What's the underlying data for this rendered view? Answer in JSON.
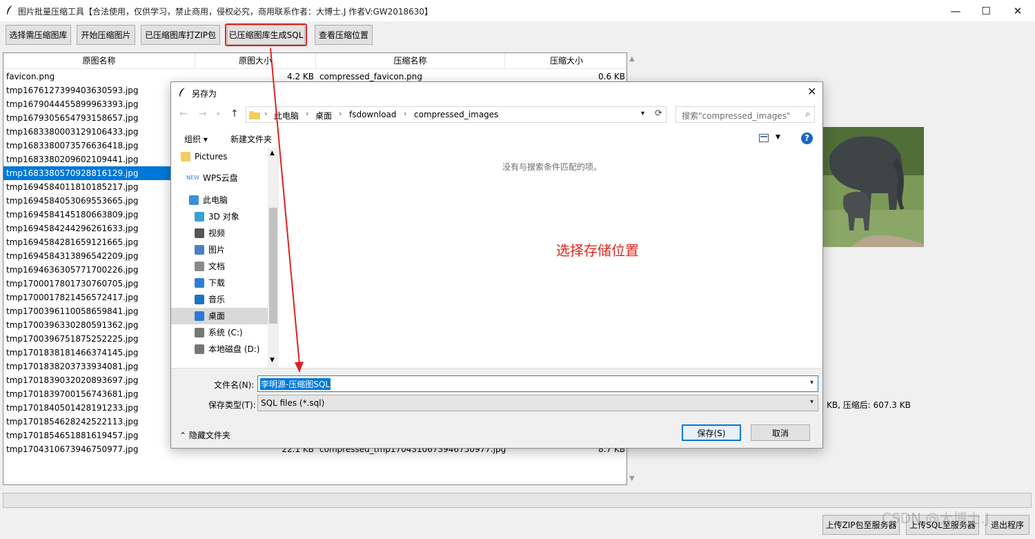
{
  "window": {
    "title": "图片批量压缩工具【合法使用，仅供学习，禁止商用，侵权必究，商用联系作者：大博士.J 作者V:GW2018630】",
    "minimize": "—",
    "maximize": "☐",
    "close": "✕"
  },
  "toolbar": {
    "select_folder": "选择需压缩图库",
    "start": "开始压缩图片",
    "zip": "已压缩图库打ZIP包",
    "gen_sql": "已压缩图库生成SQL",
    "view_location": "查看压缩位置"
  },
  "table": {
    "headers": [
      "原图名称",
      "原图大小",
      "压缩名称",
      "压缩大小"
    ],
    "rows": [
      {
        "name": "favicon.png",
        "size": "4.2 KB",
        "cname": "compressed_favicon.png",
        "csize": "0.6 KB"
      },
      {
        "name": "tmp1676127399403630593.jpg",
        "size": "",
        "cname": "",
        "csize": ""
      },
      {
        "name": "tmp1679044455899963393.jpg",
        "size": "",
        "cname": "",
        "csize": ""
      },
      {
        "name": "tmp1679305654793158657.jpg",
        "size": "",
        "cname": "",
        "csize": ""
      },
      {
        "name": "tmp1683380003129106433.jpg",
        "size": "",
        "cname": "",
        "csize": ""
      },
      {
        "name": "tmp1683380073576636418.jpg",
        "size": "",
        "cname": "",
        "csize": ""
      },
      {
        "name": "tmp1683380209602109441.jpg",
        "size": "",
        "cname": "",
        "csize": ""
      },
      {
        "name": "tmp1683380570928816129.jpg",
        "size": "",
        "cname": "",
        "csize": ""
      },
      {
        "name": "tmp1694584011810185217.jpg",
        "size": "",
        "cname": "",
        "csize": ""
      },
      {
        "name": "tmp1694584053069553665.jpg",
        "size": "",
        "cname": "",
        "csize": ""
      },
      {
        "name": "tmp1694584145180663809.jpg",
        "size": "",
        "cname": "",
        "csize": ""
      },
      {
        "name": "tmp1694584244296261633.jpg",
        "size": "",
        "cname": "",
        "csize": ""
      },
      {
        "name": "tmp1694584281659121665.jpg",
        "size": "",
        "cname": "",
        "csize": ""
      },
      {
        "name": "tmp1694584313896542209.jpg",
        "size": "",
        "cname": "",
        "csize": ""
      },
      {
        "name": "tmp1694636305771700226.jpg",
        "size": "",
        "cname": "",
        "csize": ""
      },
      {
        "name": "tmp1700017801730760705.jpg",
        "size": "",
        "cname": "",
        "csize": ""
      },
      {
        "name": "tmp1700017821456572417.jpg",
        "size": "",
        "cname": "",
        "csize": ""
      },
      {
        "name": "tmp1700396110058659841.jpg",
        "size": "",
        "cname": "",
        "csize": ""
      },
      {
        "name": "tmp1700396330280591362.jpg",
        "size": "",
        "cname": "",
        "csize": ""
      },
      {
        "name": "tmp1700396751875252225.jpg",
        "size": "",
        "cname": "",
        "csize": ""
      },
      {
        "name": "tmp1701838181466374145.jpg",
        "size": "",
        "cname": "",
        "csize": ""
      },
      {
        "name": "tmp1701838203733934081.jpg",
        "size": "",
        "cname": "",
        "csize": ""
      },
      {
        "name": "tmp1701839032020893697.jpg",
        "size": "",
        "cname": "",
        "csize": ""
      },
      {
        "name": "tmp1701839700156743681.jpg",
        "size": "",
        "cname": "",
        "csize": ""
      },
      {
        "name": "tmp1701840501428191233.jpg",
        "size": "",
        "cname": "",
        "csize": ""
      },
      {
        "name": "tmp1701854628242522113.jpg",
        "size": "",
        "cname": "",
        "csize": ""
      },
      {
        "name": "tmp1701854651881619457.jpg",
        "size": "",
        "cname": "",
        "csize": ""
      },
      {
        "name": "tmp1704310673946750977.jpg",
        "size": "22.1 KB",
        "cname": "compressed_tmp1704310673946750977.jpg",
        "csize": "8.7 KB"
      }
    ],
    "selected_index": 7
  },
  "status": {
    "summary": "KB, 压缩后: 607.3 KB"
  },
  "bottom_buttons": {
    "upload_zip": "上传ZIP包至服务器",
    "upload_sql": "上传SQL至服务器",
    "exit": "退出程序"
  },
  "watermark": "CSDN @大博士.J",
  "dialog": {
    "title": "另存为",
    "close": "✕",
    "breadcrumbs": [
      "此电脑",
      "桌面",
      "fsdownload",
      "compressed_images"
    ],
    "search_placeholder": "搜索\"compressed_images\"",
    "organize": "组织 ▾",
    "new_folder": "新建文件夹",
    "help": "?",
    "nav_items": [
      {
        "label": "Pictures",
        "icon": "folder-icon"
      },
      {
        "label": "WPS云盘",
        "icon": "wps-cloud-icon"
      },
      {
        "label": "此电脑",
        "icon": "computer-icon"
      },
      {
        "label": "3D 对象",
        "icon": "cube-icon"
      },
      {
        "label": "视频",
        "icon": "video-icon"
      },
      {
        "label": "图片",
        "icon": "picture-icon"
      },
      {
        "label": "文档",
        "icon": "document-icon"
      },
      {
        "label": "下载",
        "icon": "download-icon"
      },
      {
        "label": "音乐",
        "icon": "music-icon"
      },
      {
        "label": "桌面",
        "icon": "desktop-icon"
      },
      {
        "label": "系统 (C:)",
        "icon": "drive-c-icon"
      },
      {
        "label": "本地磁盘 (D:)",
        "icon": "drive-d-icon"
      }
    ],
    "nav_selected": "桌面",
    "wps_badge": "NEW",
    "empty_message": "没有与搜索条件匹配的项。",
    "filename_label": "文件名(N):",
    "filename_value": "李明源-压缩图SQL",
    "filetype_label": "保存类型(T):",
    "filetype_value": "SQL files (*.sql)",
    "hide_folders": "隐藏文件夹",
    "save": "保存(S)",
    "cancel": "取消"
  },
  "annotation": "选择存储位置",
  "colors": {
    "selection": "#0078d7",
    "annotation": "#e0261e",
    "highlight_box": "#e02020"
  }
}
